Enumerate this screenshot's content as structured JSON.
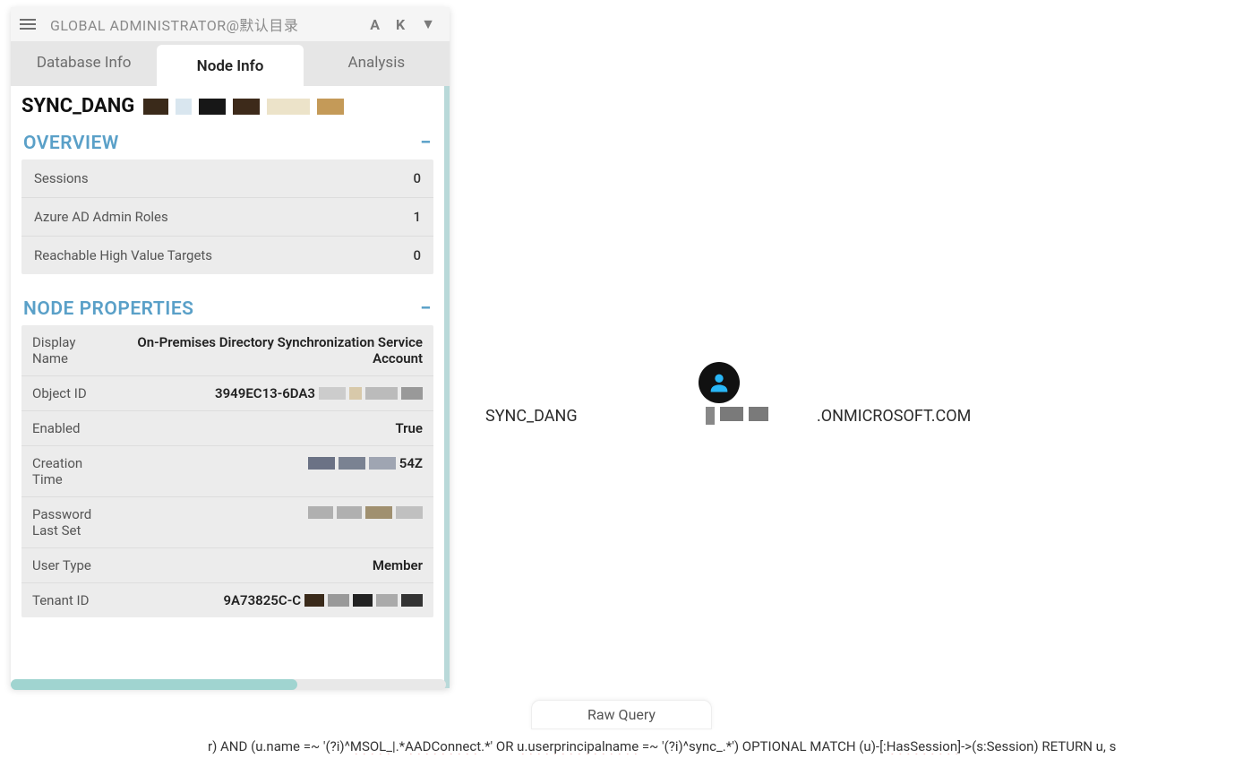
{
  "header": {
    "user_label": "GLOBAL ADMINISTRATOR@默认目录"
  },
  "tabs": {
    "db": "Database Info",
    "node": "Node Info",
    "analysis": "Analysis"
  },
  "node_title": "SYNC_DANG",
  "sections": {
    "overview_title": "OVERVIEW",
    "node_props_title": "NODE PROPERTIES"
  },
  "overview": {
    "sessions_label": "Sessions",
    "sessions_val": "0",
    "admin_roles_label": "Azure AD Admin Roles",
    "admin_roles_val": "1",
    "hvt_label": "Reachable High Value Targets",
    "hvt_val": "0"
  },
  "props": {
    "display_name_label": "Display Name",
    "display_name_val": "On-Premises Directory Synchronization Service Account",
    "object_id_label": "Object ID",
    "object_id_prefix": "3949EC13-6DA3",
    "enabled_label": "Enabled",
    "enabled_val": "True",
    "creation_label": "Creation Time",
    "creation_suffix": "54Z",
    "pwd_label": "Password Last Set",
    "user_type_label": "User Type",
    "user_type_val": "Member",
    "tenant_label": "Tenant ID",
    "tenant_prefix": "9A73825C-C"
  },
  "graph": {
    "node_label_left": "SYNC_DANG",
    "node_label_right": ".ONMICROSOFT.COM"
  },
  "raw_query": {
    "label": "Raw Query",
    "pre": "r) AND (u.name =~ '(?i)^",
    "p1": "MSOL_",
    "mid1": "|.*",
    "p2": "AADConnect",
    "mid2": ".*' OR ",
    "p3": "u.userprincipalname",
    "mid3": " =~ '(?i)^sync_.*') OPTIONAL MATCH (u)-[:",
    "p4": "HasSession",
    "post": "]->(s:Session) RETURN u, s"
  }
}
